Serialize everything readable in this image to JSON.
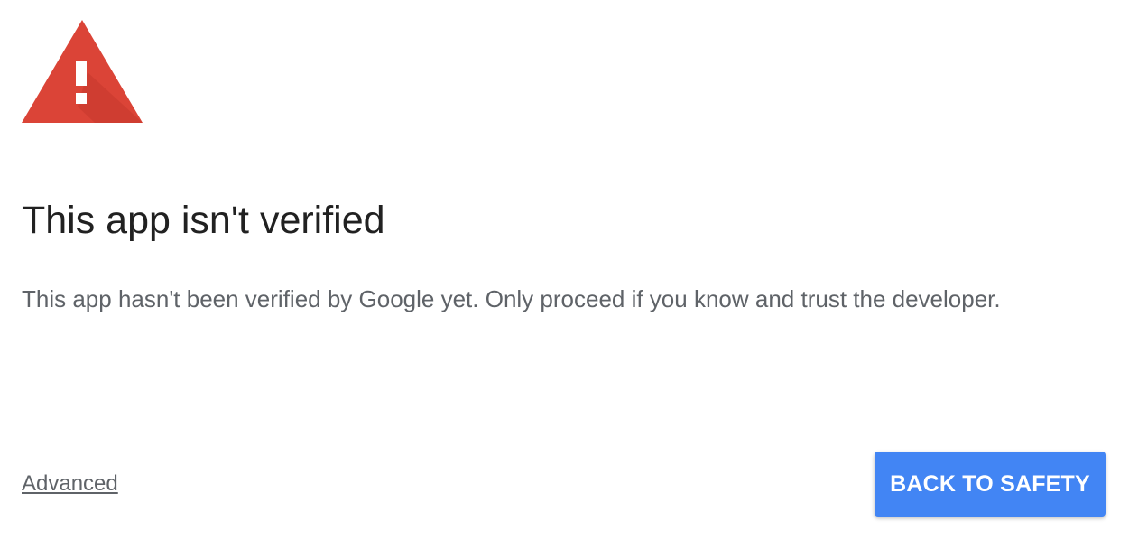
{
  "warning": {
    "icon": "warning-triangle-icon",
    "color": "#db4437"
  },
  "title": "This app isn't verified",
  "message": "This app hasn't been verified by Google yet. Only proceed if you know and trust the developer.",
  "advanced_label": "Advanced",
  "back_button_label": "BACK TO SAFETY",
  "colors": {
    "button": "#4285f4",
    "button_text": "#ffffff",
    "title": "#212121",
    "body_text": "#5f6368"
  }
}
